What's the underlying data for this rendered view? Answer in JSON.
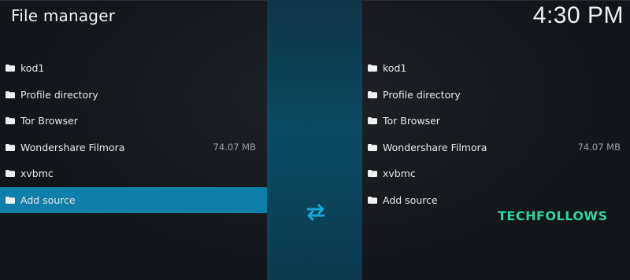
{
  "header": {
    "title": "File manager",
    "clock": "4:30 PM"
  },
  "left_pane": {
    "items": [
      {
        "label": "kod1",
        "size": ""
      },
      {
        "label": "Profile directory",
        "size": ""
      },
      {
        "label": "Tor Browser",
        "size": ""
      },
      {
        "label": "Wondershare Filmora",
        "size": "74.07 MB"
      },
      {
        "label": "xvbmc",
        "size": ""
      },
      {
        "label": "Add source",
        "size": ""
      }
    ],
    "selected_index": 5
  },
  "right_pane": {
    "items": [
      {
        "label": "kod1",
        "size": ""
      },
      {
        "label": "Profile directory",
        "size": ""
      },
      {
        "label": "Tor Browser",
        "size": ""
      },
      {
        "label": "Wondershare Filmora",
        "size": "74.07 MB"
      },
      {
        "label": "xvbmc",
        "size": ""
      },
      {
        "label": "Add source",
        "size": ""
      }
    ]
  },
  "icons": {
    "folder": "folder-icon",
    "swap": "swap-arrows-icon"
  },
  "colors": {
    "selected_row": "#0e7fa8",
    "swap_icon": "#1aa7d8",
    "watermark": "#2fd49a",
    "background": "#121519"
  },
  "watermark": "TECHFOLLOWS"
}
